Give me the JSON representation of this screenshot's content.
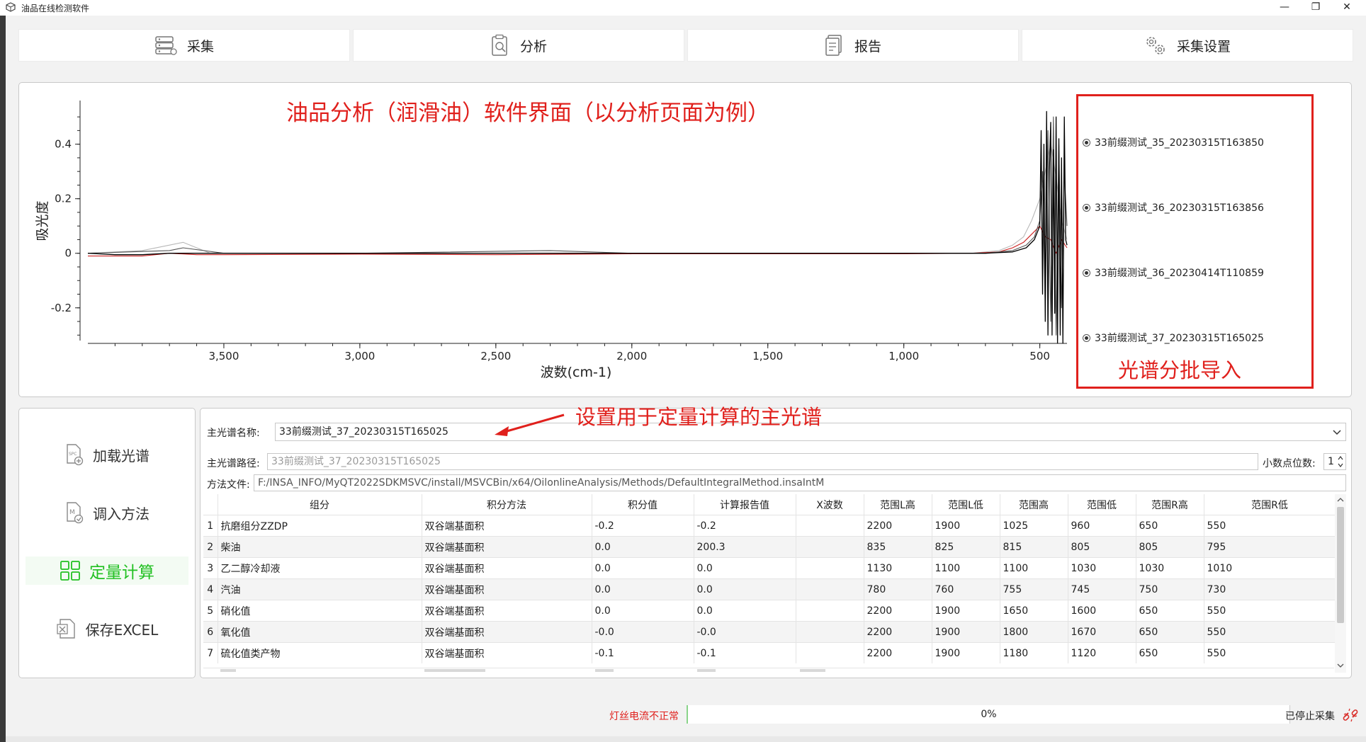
{
  "window": {
    "title": "油品在线检测软件",
    "minimize": "—",
    "restore": "❐",
    "close": "✕"
  },
  "nav": {
    "tabs": [
      {
        "label": "采集",
        "icon": "server-stack-icon"
      },
      {
        "label": "分析",
        "icon": "clipboard-analysis-icon"
      },
      {
        "label": "报告",
        "icon": "report-document-icon"
      },
      {
        "label": "采集设置",
        "icon": "gears-icon"
      }
    ]
  },
  "annotations": {
    "chart_title": "油品分析（润滑油）软件界面（以分析页面为例）",
    "legend_note": "光谱分批导入",
    "main_spectrum_note": "设置用于定量计算的主光谱"
  },
  "chart_data": {
    "type": "line",
    "xlabel": "波数(cm-1)",
    "ylabel": "吸光度",
    "x_reversed": true,
    "xlim": [
      4000,
      400
    ],
    "ylim": [
      -0.32,
      0.56
    ],
    "x_ticks": [
      {
        "value": 3500,
        "label": "3,500"
      },
      {
        "value": 3000,
        "label": "3,000"
      },
      {
        "value": 2500,
        "label": "2,500"
      },
      {
        "value": 2000,
        "label": "2,000"
      },
      {
        "value": 1500,
        "label": "1,500"
      },
      {
        "value": 1000,
        "label": "1,000"
      },
      {
        "value": 500,
        "label": "500"
      }
    ],
    "y_ticks": [
      {
        "value": 0.4,
        "label": "0.4"
      },
      {
        "value": 0.2,
        "label": "0.2"
      },
      {
        "value": 0,
        "label": "0"
      },
      {
        "value": -0.2,
        "label": "-0.2"
      }
    ],
    "series": [
      {
        "name": "33前缀测试_35_20230315T163850",
        "color": "#b8b8b8",
        "x": [
          4000,
          3800,
          3700,
          3650,
          3600,
          3550,
          3500,
          3300,
          3000,
          2500,
          2000,
          1500,
          1000,
          750,
          650,
          600,
          560,
          530,
          500,
          480,
          460,
          440,
          420,
          400
        ],
        "y": [
          0.0,
          0.01,
          0.03,
          0.04,
          0.02,
          0.0,
          0.0,
          0.0,
          0.0,
          0.0,
          0.0,
          0.0,
          0.0,
          0.0,
          0.01,
          0.03,
          0.06,
          0.12,
          0.2,
          0.3,
          0.4,
          0.28,
          0.12,
          0.05
        ]
      },
      {
        "name": "33前缀测试_36_20230315T163856",
        "color": "#cc2020",
        "x": [
          4000,
          3800,
          3700,
          3600,
          3500,
          3000,
          2500,
          2000,
          1500,
          1000,
          750,
          650,
          600,
          560,
          530,
          500,
          480,
          460,
          440,
          420,
          400
        ],
        "y": [
          -0.01,
          -0.01,
          0.0,
          -0.005,
          -0.005,
          -0.003,
          -0.005,
          -0.002,
          -0.002,
          -0.002,
          0.0,
          0.005,
          0.02,
          0.04,
          0.07,
          0.1,
          0.06,
          0.05,
          0.0,
          0.05,
          0.02
        ]
      },
      {
        "name": "33前缀测试_36_20230414T110859",
        "color": "#555555",
        "x": [
          4000,
          3700,
          3650,
          3500,
          3000,
          2300,
          2000,
          1500,
          1000,
          700,
          600,
          550,
          520,
          500,
          490,
          480,
          470,
          460,
          450,
          440,
          430,
          420,
          410,
          400
        ],
        "y": [
          0.0,
          0.01,
          0.02,
          0.0,
          0.0,
          0.01,
          0.0,
          0.0,
          0.0,
          0.0,
          0.01,
          0.03,
          0.06,
          0.12,
          0.3,
          -0.2,
          0.45,
          -0.25,
          0.5,
          -0.3,
          0.4,
          -0.2,
          0.3,
          0.1
        ]
      },
      {
        "name": "33前缀测试_37_20230315T165025",
        "color": "#000000",
        "x": [
          4000,
          3900,
          3800,
          3700,
          3600,
          3500,
          3000,
          2500,
          2300,
          2000,
          1500,
          1000,
          700,
          600,
          550,
          520,
          500,
          495,
          490,
          485,
          480,
          475,
          470,
          465,
          460,
          455,
          450,
          445,
          440,
          435,
          430,
          425,
          420,
          415,
          410,
          405,
          400
        ],
        "y": [
          0.0,
          -0.005,
          -0.005,
          0.0,
          0.0,
          0.0,
          0.0,
          0.0,
          0.0,
          0.0,
          0.0,
          0.0,
          0.0,
          0.005,
          0.02,
          0.05,
          0.1,
          0.45,
          -0.15,
          0.4,
          -0.25,
          0.52,
          -0.3,
          0.3,
          0.48,
          -0.3,
          0.38,
          -0.22,
          0.5,
          -0.33,
          0.42,
          -0.3,
          0.35,
          -0.33,
          0.5,
          0.05,
          0.03
        ]
      }
    ]
  },
  "legend": {
    "items": [
      "33前缀测试_35_20230315T163850",
      "33前缀测试_36_20230315T163856",
      "33前缀测试_36_20230414T110859",
      "33前缀测试_37_20230315T165025"
    ]
  },
  "side_menu": {
    "items": [
      {
        "label": "加载光谱",
        "icon": "spectrum-file-add-icon"
      },
      {
        "label": "调入方法",
        "icon": "method-file-icon"
      },
      {
        "label": "定量计算",
        "icon": "grid-calc-icon",
        "active": true
      },
      {
        "label": "保存EXCEL",
        "icon": "excel-file-icon"
      }
    ]
  },
  "form": {
    "main_spectrum_label": "主光谱名称:",
    "main_spectrum_value": "33前缀测试_37_20230315T165025",
    "main_path_label": "主光谱路径:",
    "main_path_value": "33前缀测试_37_20230315T165025",
    "decimal_label": "小数点位数:",
    "decimal_value": "1",
    "method_label": "方法文件:",
    "method_value": "F:/INSA_INFO/MyQT2022SDKMSVC/install/MSVCBin/x64/OilonlineAnalysis/Methods/DefaultIntegralMethod.insaIntM"
  },
  "table": {
    "headers": [
      "组分",
      "积分方法",
      "积分值",
      "计算报告值",
      "X波数",
      "范围L高",
      "范围L低",
      "范围高",
      "范围低",
      "范围R高",
      "范围R低"
    ],
    "rows": [
      {
        "n": "1",
        "cells": [
          "抗磨组分ZZDP",
          "双谷端基面积",
          "-0.2",
          "-0.2",
          "",
          "2200",
          "1900",
          "1025",
          "960",
          "650",
          "550"
        ]
      },
      {
        "n": "2",
        "cells": [
          "柴油",
          "双谷端基面积",
          "0.0",
          "200.3",
          "",
          "835",
          "825",
          "815",
          "805",
          "805",
          "795"
        ]
      },
      {
        "n": "3",
        "cells": [
          "乙二醇冷却液",
          "双谷端基面积",
          "0.0",
          "0.0",
          "",
          "1130",
          "1100",
          "1100",
          "1030",
          "1030",
          "1010"
        ]
      },
      {
        "n": "4",
        "cells": [
          "汽油",
          "双谷端基面积",
          "0.0",
          "0.0",
          "",
          "780",
          "760",
          "755",
          "745",
          "750",
          "730"
        ]
      },
      {
        "n": "5",
        "cells": [
          "硝化值",
          "双谷端基面积",
          "0.0",
          "0.0",
          "",
          "2200",
          "1900",
          "1650",
          "1600",
          "650",
          "550"
        ]
      },
      {
        "n": "6",
        "cells": [
          "氧化值",
          "双谷端基面积",
          "-0.0",
          "-0.0",
          "",
          "2200",
          "1900",
          "1800",
          "1670",
          "650",
          "550"
        ]
      },
      {
        "n": "7",
        "cells": [
          "硫化值类产物",
          "双谷端基面积",
          "-0.1",
          "-0.1",
          "",
          "2200",
          "1900",
          "1180",
          "1120",
          "650",
          "550"
        ]
      }
    ]
  },
  "status": {
    "warning": "灯丝电流不正常",
    "progress_text": "0%",
    "progress": 0,
    "state": "已停止采集",
    "warning_color": "#e0201c"
  }
}
